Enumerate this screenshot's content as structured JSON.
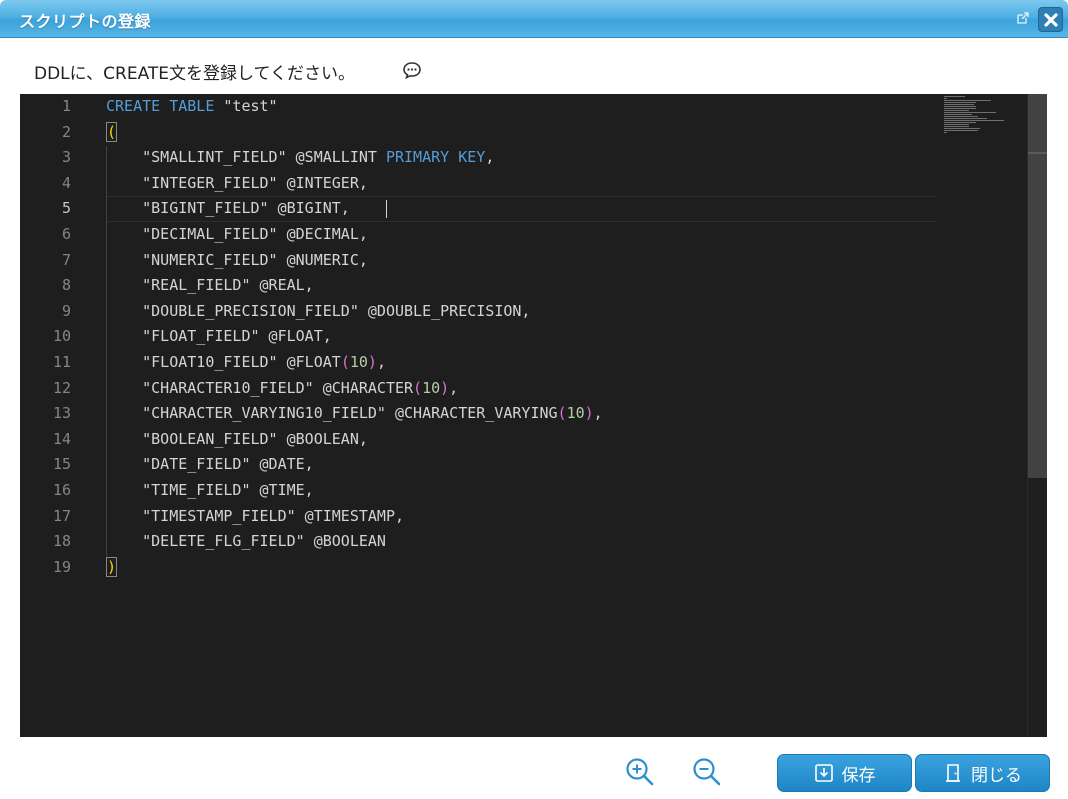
{
  "dialog": {
    "title": "スクリプトの登録",
    "instruction": "DDLに、CREATE文を登録してください。"
  },
  "editor": {
    "line_numbers": [
      "1",
      "2",
      "3",
      "4",
      "5",
      "6",
      "7",
      "8",
      "9",
      "10",
      "11",
      "12",
      "13",
      "14",
      "15",
      "16",
      "17",
      "18",
      "19"
    ],
    "active_line": 5,
    "lines": [
      [
        {
          "t": "CREATE TABLE",
          "c": "kw"
        },
        {
          "t": " \"test\"",
          "c": ""
        }
      ],
      [
        {
          "t": "(",
          "c": "p1 bracket-box"
        }
      ],
      [
        {
          "t": "    \"SMALLINT_FIELD\" @SMALLINT ",
          "c": ""
        },
        {
          "t": "PRIMARY KEY",
          "c": "kw"
        },
        {
          "t": ",",
          "c": ""
        }
      ],
      [
        {
          "t": "    \"INTEGER_FIELD\" @INTEGER,",
          "c": ""
        }
      ],
      [
        {
          "t": "    \"BIGINT_FIELD\" @BIGINT,",
          "c": ""
        }
      ],
      [
        {
          "t": "    \"DECIMAL_FIELD\" @DECIMAL,",
          "c": ""
        }
      ],
      [
        {
          "t": "    \"NUMERIC_FIELD\" @NUMERIC,",
          "c": ""
        }
      ],
      [
        {
          "t": "    \"REAL_FIELD\" @REAL,",
          "c": ""
        }
      ],
      [
        {
          "t": "    \"DOUBLE_PRECISION_FIELD\" @DOUBLE_PRECISION,",
          "c": ""
        }
      ],
      [
        {
          "t": "    \"FLOAT_FIELD\" @FLOAT,",
          "c": ""
        }
      ],
      [
        {
          "t": "    \"FLOAT10_FIELD\" @FLOAT",
          "c": ""
        },
        {
          "t": "(",
          "c": "p2"
        },
        {
          "t": "10",
          "c": "num"
        },
        {
          "t": ")",
          "c": "p2"
        },
        {
          "t": ",",
          "c": ""
        }
      ],
      [
        {
          "t": "    \"CHARACTER10_FIELD\" @CHARACTER",
          "c": ""
        },
        {
          "t": "(",
          "c": "p2"
        },
        {
          "t": "10",
          "c": "num"
        },
        {
          "t": ")",
          "c": "p2"
        },
        {
          "t": ",",
          "c": ""
        }
      ],
      [
        {
          "t": "    \"CHARACTER_VARYING10_FIELD\" @CHARACTER_VARYING",
          "c": ""
        },
        {
          "t": "(",
          "c": "p2"
        },
        {
          "t": "10",
          "c": "num"
        },
        {
          "t": ")",
          "c": "p2"
        },
        {
          "t": ",",
          "c": ""
        }
      ],
      [
        {
          "t": "    \"BOOLEAN_FIELD\" @BOOLEAN,",
          "c": ""
        }
      ],
      [
        {
          "t": "    \"DATE_FIELD\" @DATE,",
          "c": ""
        }
      ],
      [
        {
          "t": "    \"TIME_FIELD\" @TIME,",
          "c": ""
        }
      ],
      [
        {
          "t": "    \"TIMESTAMP_FIELD\" @TIMESTAMP,",
          "c": ""
        }
      ],
      [
        {
          "t": "    \"DELETE_FLG_FIELD\" @BOOLEAN",
          "c": ""
        }
      ],
      [
        {
          "t": ")",
          "c": "p1 bracket-box"
        }
      ]
    ]
  },
  "footer": {
    "zoom_in_icon": "zoom-in-icon",
    "zoom_out_icon": "zoom-out-icon",
    "save_label": "保存",
    "close_label": "閉じる"
  },
  "colors": {
    "titlebar": "#4fb0e3",
    "button": "#2b93d3",
    "editor_bg": "#1e1e1e",
    "keyword": "#569cd6",
    "number": "#b5cea8",
    "bracket_outer": "#ffd700",
    "bracket_inner": "#da70d6"
  }
}
